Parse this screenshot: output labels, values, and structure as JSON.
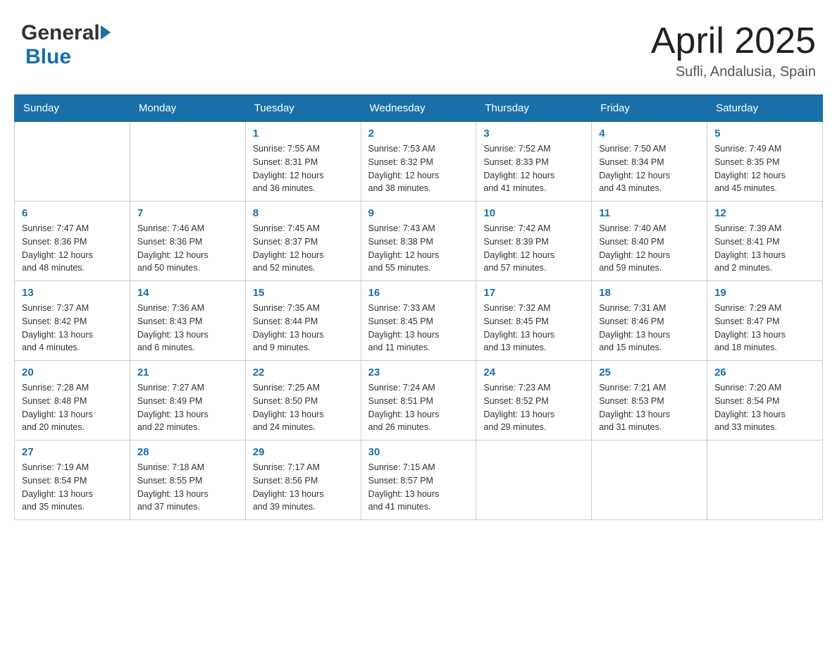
{
  "header": {
    "logo_general": "General",
    "logo_blue": "Blue",
    "title": "April 2025",
    "location": "Sufli, Andalusia, Spain"
  },
  "days_of_week": [
    "Sunday",
    "Monday",
    "Tuesday",
    "Wednesday",
    "Thursday",
    "Friday",
    "Saturday"
  ],
  "weeks": [
    [
      {
        "day": "",
        "info": ""
      },
      {
        "day": "",
        "info": ""
      },
      {
        "day": "1",
        "info": "Sunrise: 7:55 AM\nSunset: 8:31 PM\nDaylight: 12 hours\nand 36 minutes."
      },
      {
        "day": "2",
        "info": "Sunrise: 7:53 AM\nSunset: 8:32 PM\nDaylight: 12 hours\nand 38 minutes."
      },
      {
        "day": "3",
        "info": "Sunrise: 7:52 AM\nSunset: 8:33 PM\nDaylight: 12 hours\nand 41 minutes."
      },
      {
        "day": "4",
        "info": "Sunrise: 7:50 AM\nSunset: 8:34 PM\nDaylight: 12 hours\nand 43 minutes."
      },
      {
        "day": "5",
        "info": "Sunrise: 7:49 AM\nSunset: 8:35 PM\nDaylight: 12 hours\nand 45 minutes."
      }
    ],
    [
      {
        "day": "6",
        "info": "Sunrise: 7:47 AM\nSunset: 8:36 PM\nDaylight: 12 hours\nand 48 minutes."
      },
      {
        "day": "7",
        "info": "Sunrise: 7:46 AM\nSunset: 8:36 PM\nDaylight: 12 hours\nand 50 minutes."
      },
      {
        "day": "8",
        "info": "Sunrise: 7:45 AM\nSunset: 8:37 PM\nDaylight: 12 hours\nand 52 minutes."
      },
      {
        "day": "9",
        "info": "Sunrise: 7:43 AM\nSunset: 8:38 PM\nDaylight: 12 hours\nand 55 minutes."
      },
      {
        "day": "10",
        "info": "Sunrise: 7:42 AM\nSunset: 8:39 PM\nDaylight: 12 hours\nand 57 minutes."
      },
      {
        "day": "11",
        "info": "Sunrise: 7:40 AM\nSunset: 8:40 PM\nDaylight: 12 hours\nand 59 minutes."
      },
      {
        "day": "12",
        "info": "Sunrise: 7:39 AM\nSunset: 8:41 PM\nDaylight: 13 hours\nand 2 minutes."
      }
    ],
    [
      {
        "day": "13",
        "info": "Sunrise: 7:37 AM\nSunset: 8:42 PM\nDaylight: 13 hours\nand 4 minutes."
      },
      {
        "day": "14",
        "info": "Sunrise: 7:36 AM\nSunset: 8:43 PM\nDaylight: 13 hours\nand 6 minutes."
      },
      {
        "day": "15",
        "info": "Sunrise: 7:35 AM\nSunset: 8:44 PM\nDaylight: 13 hours\nand 9 minutes."
      },
      {
        "day": "16",
        "info": "Sunrise: 7:33 AM\nSunset: 8:45 PM\nDaylight: 13 hours\nand 11 minutes."
      },
      {
        "day": "17",
        "info": "Sunrise: 7:32 AM\nSunset: 8:45 PM\nDaylight: 13 hours\nand 13 minutes."
      },
      {
        "day": "18",
        "info": "Sunrise: 7:31 AM\nSunset: 8:46 PM\nDaylight: 13 hours\nand 15 minutes."
      },
      {
        "day": "19",
        "info": "Sunrise: 7:29 AM\nSunset: 8:47 PM\nDaylight: 13 hours\nand 18 minutes."
      }
    ],
    [
      {
        "day": "20",
        "info": "Sunrise: 7:28 AM\nSunset: 8:48 PM\nDaylight: 13 hours\nand 20 minutes."
      },
      {
        "day": "21",
        "info": "Sunrise: 7:27 AM\nSunset: 8:49 PM\nDaylight: 13 hours\nand 22 minutes."
      },
      {
        "day": "22",
        "info": "Sunrise: 7:25 AM\nSunset: 8:50 PM\nDaylight: 13 hours\nand 24 minutes."
      },
      {
        "day": "23",
        "info": "Sunrise: 7:24 AM\nSunset: 8:51 PM\nDaylight: 13 hours\nand 26 minutes."
      },
      {
        "day": "24",
        "info": "Sunrise: 7:23 AM\nSunset: 8:52 PM\nDaylight: 13 hours\nand 29 minutes."
      },
      {
        "day": "25",
        "info": "Sunrise: 7:21 AM\nSunset: 8:53 PM\nDaylight: 13 hours\nand 31 minutes."
      },
      {
        "day": "26",
        "info": "Sunrise: 7:20 AM\nSunset: 8:54 PM\nDaylight: 13 hours\nand 33 minutes."
      }
    ],
    [
      {
        "day": "27",
        "info": "Sunrise: 7:19 AM\nSunset: 8:54 PM\nDaylight: 13 hours\nand 35 minutes."
      },
      {
        "day": "28",
        "info": "Sunrise: 7:18 AM\nSunset: 8:55 PM\nDaylight: 13 hours\nand 37 minutes."
      },
      {
        "day": "29",
        "info": "Sunrise: 7:17 AM\nSunset: 8:56 PM\nDaylight: 13 hours\nand 39 minutes."
      },
      {
        "day": "30",
        "info": "Sunrise: 7:15 AM\nSunset: 8:57 PM\nDaylight: 13 hours\nand 41 minutes."
      },
      {
        "day": "",
        "info": ""
      },
      {
        "day": "",
        "info": ""
      },
      {
        "day": "",
        "info": ""
      }
    ]
  ]
}
